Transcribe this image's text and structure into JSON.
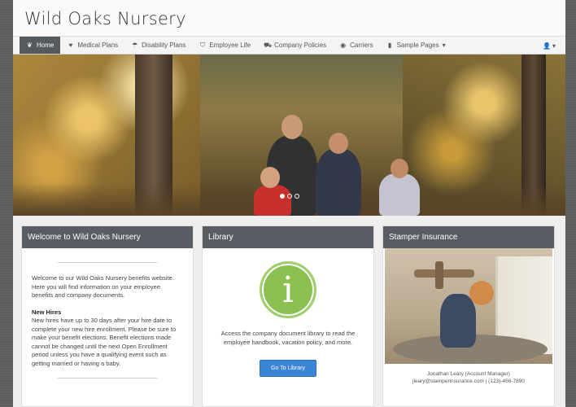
{
  "brand": {
    "title": "Wild Oaks Nursery"
  },
  "nav": {
    "items": [
      {
        "label": "Home",
        "icon": "leaf-icon",
        "glyph": "❦",
        "active": true
      },
      {
        "label": "Medical Plans",
        "icon": "heart-icon",
        "glyph": "♥",
        "active": false
      },
      {
        "label": "Disability Plans",
        "icon": "umbrella-icon",
        "glyph": "☂",
        "active": false
      },
      {
        "label": "Employee Life",
        "icon": "shield-icon",
        "glyph": "⛉",
        "active": false
      },
      {
        "label": "Company Policies",
        "icon": "car-icon",
        "glyph": "⛟",
        "active": false
      },
      {
        "label": "Carriers",
        "icon": "circle-dot-icon",
        "glyph": "◉",
        "active": false
      },
      {
        "label": "Sample Pages",
        "icon": "bookmark-icon",
        "glyph": "▮",
        "active": false
      }
    ],
    "user_glyph": "👤",
    "caret": "▾"
  },
  "hero": {
    "slides": 3,
    "active_slide": 0
  },
  "welcome": {
    "header": "Welcome to Wild Oaks Nursery",
    "intro": "Welcome to our Wild Oaks Nursery benefits website. Here you will find information on your employee benefits and company documents.",
    "new_hires_title": "New Hires",
    "new_hires_text": "New hires have up to 30 days after your hire date to complete your new hire enrollment. Please be sure to make your benefit elections. Benefit elections made cannot be changed until the next Open Enrollment period unless you have a qualifying event such as getting married or having a baby."
  },
  "library": {
    "header": "Library",
    "icon_glyph": "i",
    "text": "Access the company document library to read the employee handbook, vacation policy, and more.",
    "button": "Go To Library"
  },
  "insurance": {
    "header": "Stamper Insurance",
    "caption_line1": "Jonathan Leary (Account Manager)",
    "caption_line2": "jleary@stamperinsurance.com | (123)-456-7890"
  }
}
